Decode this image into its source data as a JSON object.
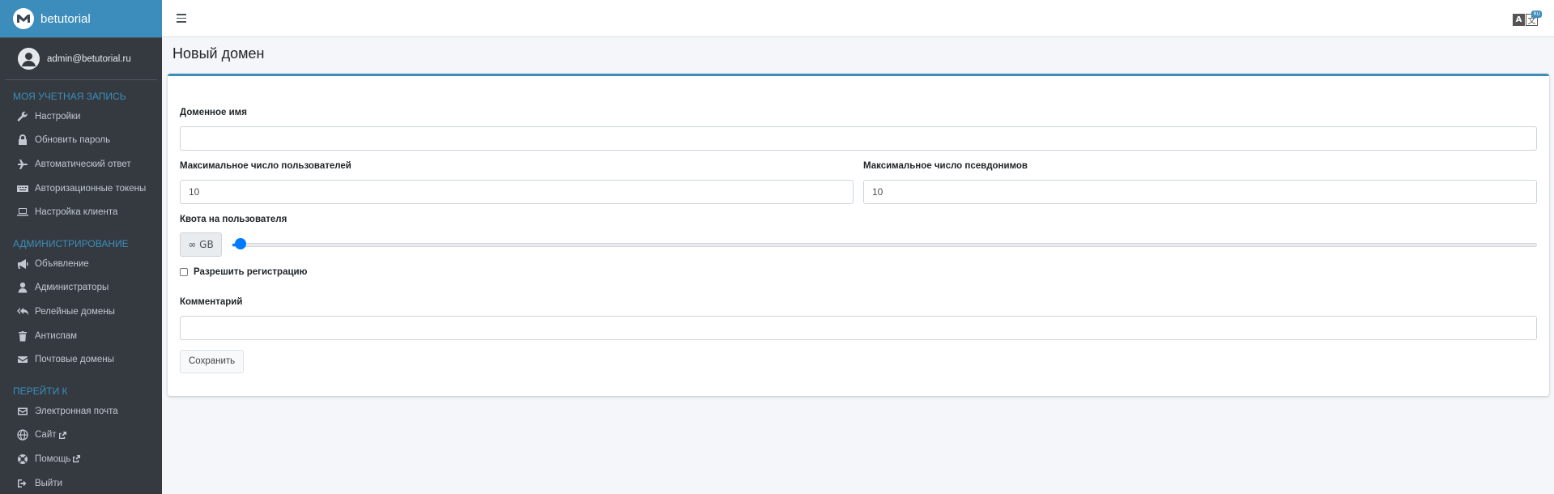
{
  "brand": {
    "name": "betutorial",
    "logo_icon": "mail-logo-icon"
  },
  "user": {
    "email": "admin@betutorial.ru",
    "avatar_icon": "user-avatar-icon"
  },
  "sidebar": {
    "sections": [
      {
        "header": "МОЯ УЧЕТНАЯ ЗАПИСЬ",
        "items": [
          {
            "label": "Настройки",
            "icon": "wrench-icon"
          },
          {
            "label": "Обновить пароль",
            "icon": "lock-icon"
          },
          {
            "label": "Автоматический ответ",
            "icon": "plane-icon"
          },
          {
            "label": "Авторизационные токены",
            "icon": "keyboard-icon"
          },
          {
            "label": "Настройка клиента",
            "icon": "laptop-icon"
          }
        ]
      },
      {
        "header": "АДМИНИСТРИРОВАНИЕ",
        "items": [
          {
            "label": "Объявление",
            "icon": "bullhorn-icon"
          },
          {
            "label": "Администраторы",
            "icon": "user-icon"
          },
          {
            "label": "Релейные домены",
            "icon": "reply-all-icon"
          },
          {
            "label": "Антиспам",
            "icon": "trash-icon"
          },
          {
            "label": "Почтовые домены",
            "icon": "envelope-icon"
          }
        ]
      },
      {
        "header": "ПЕРЕЙТИ К",
        "items": [
          {
            "label": "Электронная почта",
            "icon": "envelope-outline-icon"
          },
          {
            "label": "Сайт",
            "icon": "globe-icon",
            "external": true
          },
          {
            "label": "Помощь",
            "icon": "life-ring-icon",
            "external": true
          },
          {
            "label": "Выйти",
            "icon": "sign-out-icon"
          }
        ]
      }
    ]
  },
  "topbar": {
    "menu_icon": "hamburger-icon",
    "language_icon": "translate-icon",
    "language_badge": "RU"
  },
  "page": {
    "title": "Новый домен"
  },
  "form": {
    "domain_name": {
      "label": "Доменное имя",
      "value": ""
    },
    "max_users": {
      "label": "Максимальное число пользователей",
      "value": "10"
    },
    "max_aliases": {
      "label": "Максимальное число псевдонимов",
      "value": "10"
    },
    "quota": {
      "label": "Квота на пользователя",
      "addon": "∞ GB",
      "slider_fraction": 0.007
    },
    "signup": {
      "label": "Разрешить регистрацию",
      "checked": false
    },
    "comment": {
      "label": "Комментарий",
      "value": ""
    },
    "save_label": "Сохранить"
  },
  "colors": {
    "accent": "#3c8dbc",
    "sidebar_bg": "#343a40",
    "slider": "#007bff"
  }
}
